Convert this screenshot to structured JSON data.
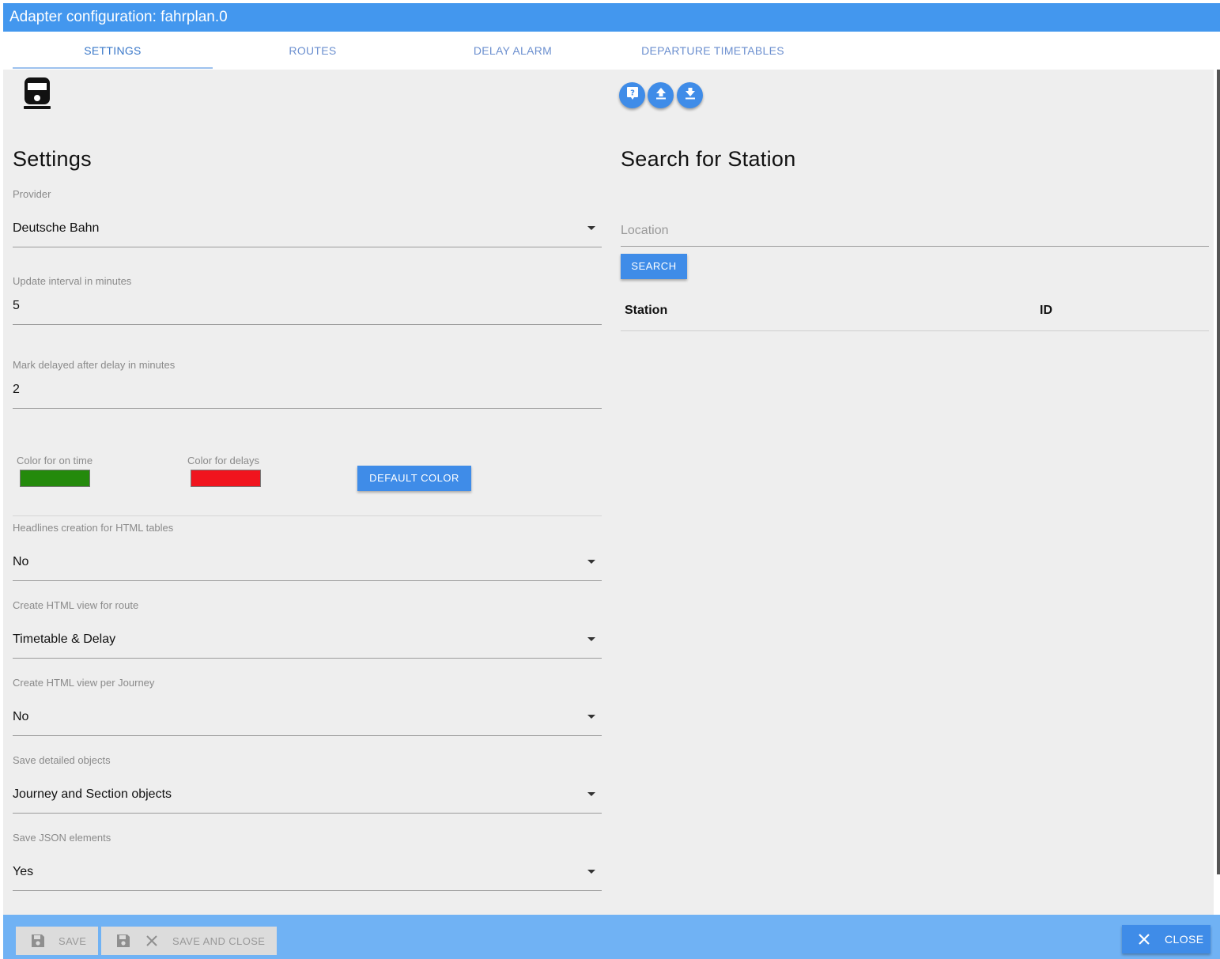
{
  "window": {
    "title": "Adapter configuration: fahrplan.0"
  },
  "tabs": [
    {
      "label": "SETTINGS",
      "active": true
    },
    {
      "label": "ROUTES"
    },
    {
      "label": "DELAY ALARM"
    },
    {
      "label": "DEPARTURE TIMETABLES"
    }
  ],
  "toolbar": {
    "icons": [
      "help-icon",
      "upload-icon",
      "download-icon"
    ]
  },
  "settings": {
    "title": "Settings",
    "provider": {
      "label": "Provider",
      "value": "Deutsche Bahn"
    },
    "update_interval": {
      "label": "Update interval in minutes",
      "value": "5"
    },
    "mark_delayed": {
      "label": "Mark delayed after delay in minutes",
      "value": "2"
    },
    "colors": {
      "on_time_label": "Color for on time",
      "on_time_color": "#248a0c",
      "delays_label": "Color for delays",
      "delays_color": "#f0141e",
      "default_button": "DEFAULT COLOR"
    },
    "headlines": {
      "label": "Headlines creation for HTML tables",
      "value": "No"
    },
    "html_route": {
      "label": "Create HTML view for route",
      "value": "Timetable & Delay"
    },
    "html_journey": {
      "label": "Create HTML view per Journey",
      "value": "No"
    },
    "detailed_objects": {
      "label": "Save detailed objects",
      "value": "Journey and Section objects"
    },
    "json_elements": {
      "label": "Save JSON elements",
      "value": "Yes"
    }
  },
  "station_search": {
    "title": "Search for Station",
    "location_placeholder": "Location",
    "location_value": "",
    "search_button": "SEARCH",
    "columns": [
      "Station",
      "ID"
    ]
  },
  "footer": {
    "save": "SAVE",
    "save_and_close": "SAVE AND CLOSE",
    "close": "CLOSE"
  }
}
